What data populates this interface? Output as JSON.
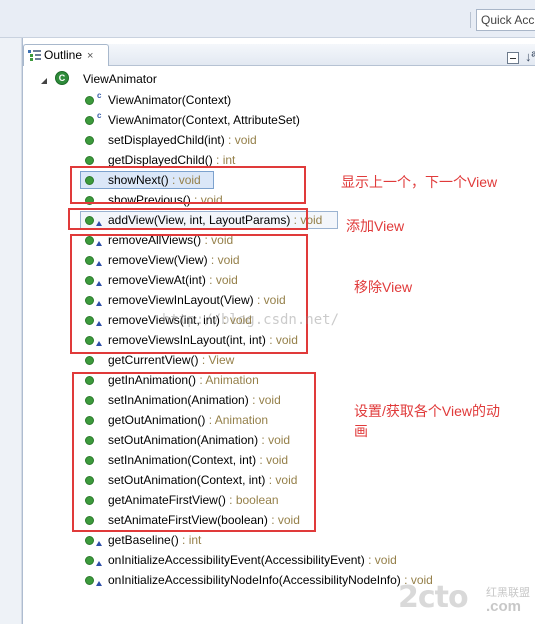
{
  "toolbar": {
    "quick_access": "Quick Acc"
  },
  "outline": {
    "tab_label": "Outline",
    "tab_close": "×",
    "sort_label": "↓ª",
    "root": "ViewAnimator",
    "methods": [
      {
        "name": "ViewAnimator(Context)",
        "type": ""
      },
      {
        "name": "ViewAnimator(Context, AttributeSet)",
        "type": ""
      },
      {
        "name": "setDisplayedChild(int)",
        "type": " : void"
      },
      {
        "name": "getDisplayedChild()",
        "type": " : int"
      },
      {
        "name": "showNext()",
        "type": " : void"
      },
      {
        "name": "showPrevious()",
        "type": " : void"
      },
      {
        "name": "addView(View, int, LayoutParams)",
        "type": " : void"
      },
      {
        "name": "removeAllViews()",
        "type": " : void"
      },
      {
        "name": "removeView(View)",
        "type": " : void"
      },
      {
        "name": "removeViewAt(int)",
        "type": " : void"
      },
      {
        "name": "removeViewInLayout(View)",
        "type": " : void"
      },
      {
        "name": "removeViews(int, int)",
        "type": " : void"
      },
      {
        "name": "removeViewsInLayout(int, int)",
        "type": " : void"
      },
      {
        "name": "getCurrentView()",
        "type": " : View"
      },
      {
        "name": "getInAnimation()",
        "type": " : Animation"
      },
      {
        "name": "setInAnimation(Animation)",
        "type": " : void"
      },
      {
        "name": "getOutAnimation()",
        "type": " : Animation"
      },
      {
        "name": "setOutAnimation(Animation)",
        "type": " : void"
      },
      {
        "name": "setInAnimation(Context, int)",
        "type": " : void"
      },
      {
        "name": "setOutAnimation(Context, int)",
        "type": " : void"
      },
      {
        "name": "getAnimateFirstView()",
        "type": " : boolean"
      },
      {
        "name": "setAnimateFirstView(boolean)",
        "type": " : void"
      },
      {
        "name": "getBaseline()",
        "type": " : int"
      },
      {
        "name": "onInitializeAccessibilityEvent(AccessibilityEvent)",
        "type": " : void"
      },
      {
        "name": "onInitializeAccessibilityNodeInfo(AccessibilityNodeInfo)",
        "type": " : void"
      }
    ]
  },
  "annotations": {
    "show": "显示上一个，下一个View",
    "add": "添加View",
    "remove": "移除View",
    "animation_line1": "设置/获取各个View的动",
    "animation_line2": "画"
  },
  "watermark": "http://blog.csdn.net/",
  "logo": {
    "main": "2cto",
    "cn": "红黑联盟",
    "com": ".com"
  },
  "colors": {
    "annotation_red": "#e03a3a",
    "return_type": "#95804a",
    "method_green": "#3c9a3c"
  }
}
